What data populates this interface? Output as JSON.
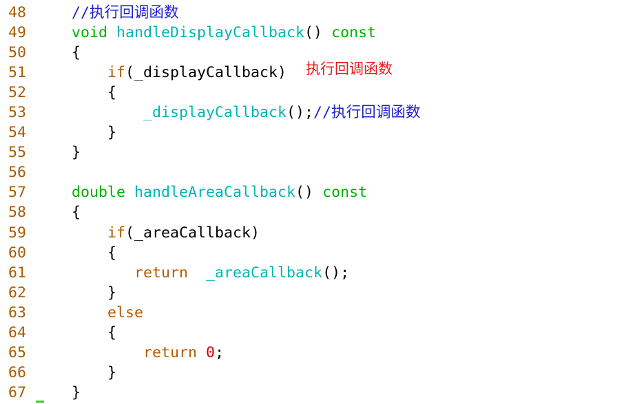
{
  "editor": {
    "lines": [
      {
        "number": "48",
        "tokens": [
          {
            "t": "//执行回调函数",
            "c": "cm"
          }
        ]
      },
      {
        "number": "49",
        "tokens": [
          {
            "t": "void",
            "c": "type"
          },
          {
            "t": " ",
            "c": "plain"
          },
          {
            "t": "handleDisplayCallback",
            "c": "fn"
          },
          {
            "t": "() ",
            "c": "plain"
          },
          {
            "t": "const",
            "c": "type"
          }
        ]
      },
      {
        "number": "50",
        "tokens": [
          {
            "t": "{",
            "c": "plain"
          }
        ]
      },
      {
        "number": "51",
        "tokens": [
          {
            "t": "    ",
            "c": "plain"
          },
          {
            "t": "if",
            "c": "kw"
          },
          {
            "t": "(_displayCallback)",
            "c": "plain"
          }
        ]
      },
      {
        "number": "52",
        "tokens": [
          {
            "t": "    {",
            "c": "plain"
          }
        ]
      },
      {
        "number": "53",
        "tokens": [
          {
            "t": "        ",
            "c": "plain"
          },
          {
            "t": "_displayCallback",
            "c": "fn"
          },
          {
            "t": "();",
            "c": "plain"
          },
          {
            "t": "//执行回调函数",
            "c": "cm"
          }
        ]
      },
      {
        "number": "54",
        "tokens": [
          {
            "t": "    }",
            "c": "plain"
          }
        ]
      },
      {
        "number": "55",
        "tokens": [
          {
            "t": "}",
            "c": "plain"
          }
        ]
      },
      {
        "number": "56",
        "tokens": []
      },
      {
        "number": "57",
        "tokens": [
          {
            "t": "double",
            "c": "type"
          },
          {
            "t": " ",
            "c": "plain"
          },
          {
            "t": "handleAreaCallback",
            "c": "fn"
          },
          {
            "t": "() ",
            "c": "plain"
          },
          {
            "t": "const",
            "c": "type"
          }
        ]
      },
      {
        "number": "58",
        "tokens": [
          {
            "t": "{",
            "c": "plain"
          }
        ]
      },
      {
        "number": "59",
        "tokens": [
          {
            "t": "    ",
            "c": "plain"
          },
          {
            "t": "if",
            "c": "kw"
          },
          {
            "t": "(_areaCallback)",
            "c": "plain"
          }
        ]
      },
      {
        "number": "60",
        "tokens": [
          {
            "t": "    {",
            "c": "plain"
          }
        ]
      },
      {
        "number": "61",
        "tokens": [
          {
            "t": "       ",
            "c": "plain"
          },
          {
            "t": "return",
            "c": "kw"
          },
          {
            "t": "  ",
            "c": "plain"
          },
          {
            "t": "_areaCallback",
            "c": "fn"
          },
          {
            "t": "();",
            "c": "plain"
          }
        ]
      },
      {
        "number": "62",
        "tokens": [
          {
            "t": "    }",
            "c": "plain"
          }
        ]
      },
      {
        "number": "63",
        "tokens": [
          {
            "t": "    ",
            "c": "plain"
          },
          {
            "t": "else",
            "c": "kw"
          }
        ]
      },
      {
        "number": "64",
        "tokens": [
          {
            "t": "    {",
            "c": "plain"
          }
        ]
      },
      {
        "number": "65",
        "tokens": [
          {
            "t": "        ",
            "c": "plain"
          },
          {
            "t": "return",
            "c": "kw"
          },
          {
            "t": " ",
            "c": "plain"
          },
          {
            "t": "0",
            "c": "num"
          },
          {
            "t": ";",
            "c": "plain"
          }
        ]
      },
      {
        "number": "66",
        "tokens": [
          {
            "t": "    }",
            "c": "plain"
          }
        ]
      },
      {
        "number": "67",
        "tokens": [
          {
            "t": "}",
            "c": "plain"
          }
        ]
      }
    ]
  },
  "annotation": {
    "text": "执行回调函数"
  },
  "colors": {
    "keyword": "#b35c00",
    "type": "#00b000",
    "function": "#00b5b5",
    "comment": "#2222cc",
    "number": "#d00000",
    "annotation": "#e81818",
    "cursor": "#22dd00"
  }
}
